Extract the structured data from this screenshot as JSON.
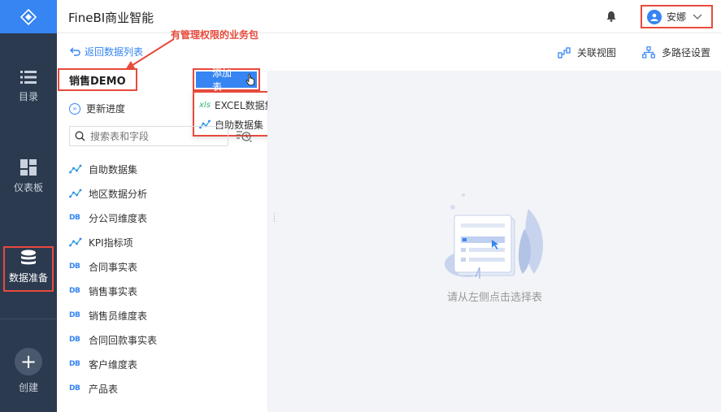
{
  "app": {
    "title": "FineBI商业智能"
  },
  "header": {
    "user_name": "安娜"
  },
  "nav": {
    "items": [
      {
        "label": "目录"
      },
      {
        "label": "仪表板"
      },
      {
        "label": "数据准备"
      },
      {
        "label": "创建"
      }
    ]
  },
  "toolbar": {
    "back_label": "返回数据列表",
    "annotation": "有管理权限的业务包",
    "relation_view": "关联视图",
    "multipath": "多路径设置"
  },
  "package": {
    "name": "销售DEMO",
    "add_table_label": "添加表",
    "dropdown": [
      {
        "icon": "xls",
        "label": "EXCEL数据集"
      },
      {
        "icon": "self-service",
        "label": "自助数据集"
      }
    ],
    "update_progress": "更新进度",
    "search_placeholder": "搜索表和字段"
  },
  "tables": [
    {
      "type": "self",
      "label": "自助数据集"
    },
    {
      "type": "self",
      "label": "地区数据分析"
    },
    {
      "type": "db",
      "label": "分公司维度表"
    },
    {
      "type": "self",
      "label": "KPI指标项"
    },
    {
      "type": "db",
      "label": "合同事实表"
    },
    {
      "type": "db",
      "label": "销售事实表"
    },
    {
      "type": "db",
      "label": "销售员维度表"
    },
    {
      "type": "db",
      "label": "合同回款事实表"
    },
    {
      "type": "db",
      "label": "客户维度表"
    },
    {
      "type": "db",
      "label": "产品表"
    }
  ],
  "icon_text": {
    "db": "DB",
    "xls": "xls"
  },
  "main": {
    "empty_text": "请从左侧点击选择表"
  },
  "colors": {
    "accent": "#3685f2",
    "annotation": "#e84a3c",
    "nav_bg": "#2c3a4f"
  }
}
